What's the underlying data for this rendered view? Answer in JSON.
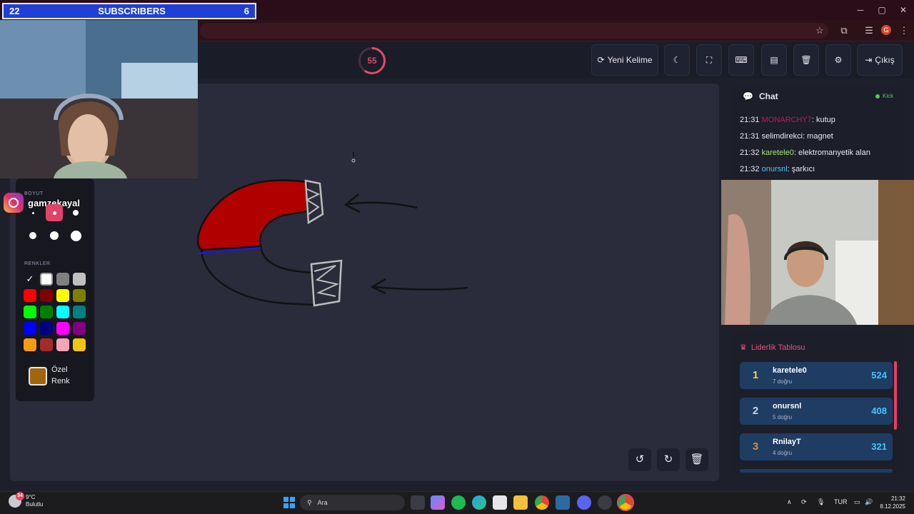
{
  "subscribers": {
    "left": "22",
    "label": "SUBSCRIBERS",
    "right": "6"
  },
  "window_controls": {
    "minimize": "─",
    "maximize": "▢",
    "close": "✕"
  },
  "browser": {
    "profile_initial": "G"
  },
  "header": {
    "timer": "55",
    "timer_fraction": 0.6,
    "new_word": "Yeni Kelime",
    "exit": "Çıkış"
  },
  "overlay": {
    "instagram_handle": "gamzekayal"
  },
  "tools": {
    "size_label": "BOYUT",
    "colors_label": "RENKLER",
    "custom_color_line1": "Özel",
    "custom_color_line2": "Renk",
    "custom_color": "#a1660b",
    "palette": [
      "#000000",
      "#ffffff",
      "#808080",
      "#c0c0c0",
      "#ff0000",
      "#800000",
      "#ffff00",
      "#808000",
      "#00ff00",
      "#008000",
      "#00ffff",
      "#008080",
      "#0000ff",
      "#000080",
      "#ff00ff",
      "#800080",
      "#f39c12",
      "#a52a2a",
      "#f4a6b8",
      "#f1c40f"
    ],
    "selected_color": "#000000"
  },
  "chat": {
    "title": "Chat",
    "platform": "Kick",
    "messages": [
      {
        "time": "21:31",
        "user": "MONARCHY7",
        "text": ": kutup",
        "color": "#c2185b"
      },
      {
        "time": "21:31",
        "user": "selimdirekci",
        "text": ": magnet",
        "color": "#e8e8f0"
      },
      {
        "time": "21:32",
        "user": "karetele0",
        "text": ": elektromanyetik alan",
        "color": "#a4e36d"
      },
      {
        "time": "21:32",
        "user": "onursnl",
        "text": ": şarkıcı",
        "color": "#4fc3f7"
      }
    ]
  },
  "leaderboard": {
    "title": "Liderlik Tablosu",
    "rows": [
      {
        "rank": "1",
        "name": "karetele0",
        "sub": "7 doğru",
        "score": "524",
        "rank_color": "#f5d33b"
      },
      {
        "rank": "2",
        "name": "onursnl",
        "sub": "5 doğru",
        "score": "408",
        "rank_color": "#cdd6e4"
      },
      {
        "rank": "3",
        "name": "RnilayT",
        "sub": "4 doğru",
        "score": "321",
        "rank_color": "#d98b3a"
      }
    ]
  },
  "taskbar": {
    "weather_temp": "9°C",
    "weather_desc": "Bulutlu",
    "weather_badge": "34",
    "search_placeholder": "Ara",
    "language": "TUR",
    "time": "21:32",
    "date": "8.12.2025"
  }
}
